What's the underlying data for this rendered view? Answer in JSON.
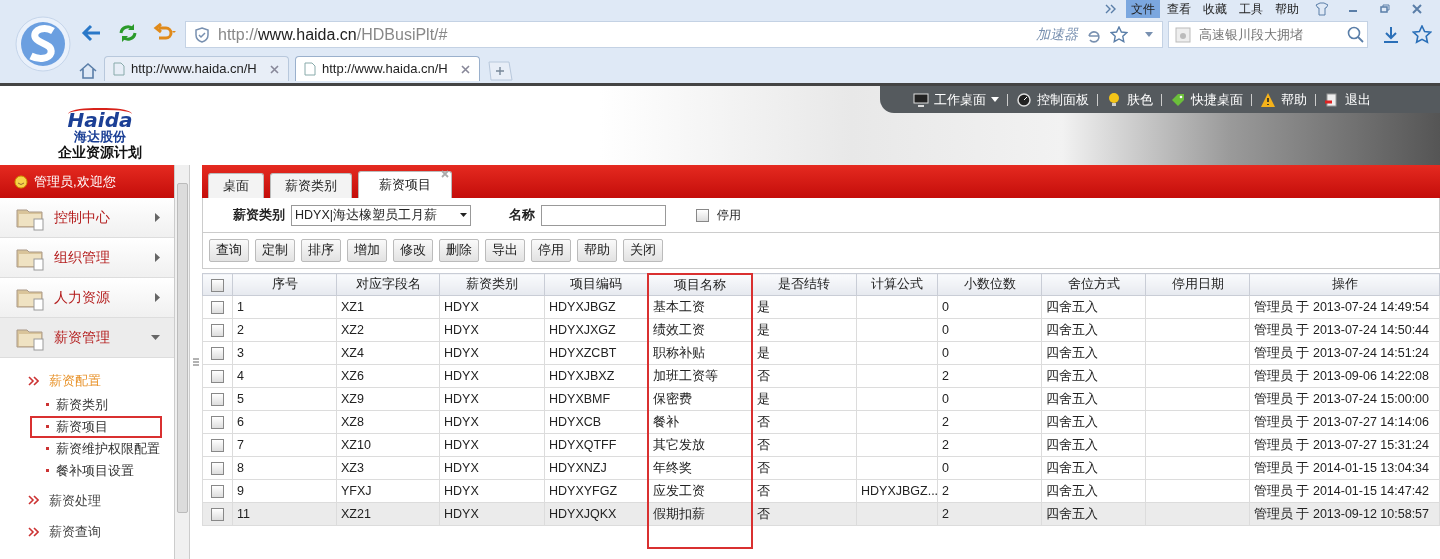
{
  "browser": {
    "menu": [
      {
        "label": "文件",
        "selected": true
      },
      {
        "label": "查看",
        "selected": false
      },
      {
        "label": "收藏",
        "selected": false
      },
      {
        "label": "工具",
        "selected": false
      },
      {
        "label": "帮助",
        "selected": false
      }
    ],
    "address": {
      "scheme": "http://",
      "host": "www.haida.cn",
      "path": "/HDBusiPlt/#"
    },
    "accelerator": "加速器",
    "search": {
      "placeholder": "高速银川段大拥堵"
    },
    "tabs": [
      {
        "label": "http://www.haida.cn/H",
        "selected": false
      },
      {
        "label": "http://www.haida.cn/H",
        "selected": true
      }
    ]
  },
  "header": {
    "logo": {
      "wordmark": "Haida",
      "company": "海达股份",
      "system": "企业资源计划"
    },
    "toolbar": [
      {
        "kind": "monitor",
        "label": "工作桌面",
        "dropdown": true
      },
      {
        "kind": "gauge",
        "label": "控制面板",
        "dropdown": false
      },
      {
        "kind": "bulb",
        "label": "肤色",
        "dropdown": false
      },
      {
        "kind": "tag",
        "label": "快捷桌面",
        "dropdown": false
      },
      {
        "kind": "warning",
        "label": "帮助",
        "dropdown": false
      },
      {
        "kind": "exit",
        "label": "退出",
        "dropdown": false
      }
    ]
  },
  "sidebar": {
    "user": "管理员,欢迎您",
    "groups": [
      {
        "label": "控制中心",
        "expanded": false
      },
      {
        "label": "组织管理",
        "expanded": false
      },
      {
        "label": "人力资源",
        "expanded": false
      },
      {
        "label": "薪资管理",
        "expanded": true,
        "sections": [
          {
            "label": "薪资配置",
            "selected": true,
            "children": [
              {
                "label": "薪资类别",
                "highlighted": false
              },
              {
                "label": "薪资项目",
                "highlighted": true
              },
              {
                "label": "薪资维护权限配置",
                "highlighted": false
              },
              {
                "label": "餐补项目设置",
                "highlighted": false
              }
            ]
          },
          {
            "label": "薪资处理",
            "selected": false
          },
          {
            "label": "薪资查询",
            "selected": false
          }
        ]
      }
    ]
  },
  "tabs": [
    {
      "label": "桌面",
      "selected": false,
      "closable": false
    },
    {
      "label": "薪资类别",
      "selected": false,
      "closable": false
    },
    {
      "label": "薪资项目",
      "selected": true,
      "closable": true
    }
  ],
  "filter": {
    "category_label": "薪资类别",
    "category_value": "HDYX|海达橡塑员工月薪",
    "name_label": "名称",
    "disabled_label": "停用",
    "disabled_checked": false
  },
  "buttons": [
    "查询",
    "定制",
    "排序",
    "增加",
    "修改",
    "删除",
    "导出",
    "停用",
    "帮助",
    "关闭"
  ],
  "table": {
    "select_all_checked": false,
    "columns": [
      {
        "label": "序号",
        "highlighted": false
      },
      {
        "label": "对应字段名",
        "highlighted": false
      },
      {
        "label": "薪资类别",
        "highlighted": false
      },
      {
        "label": "项目编码",
        "highlighted": false
      },
      {
        "label": "项目名称",
        "highlighted": true
      },
      {
        "label": "是否结转",
        "highlighted": false
      },
      {
        "label": "计算公式",
        "highlighted": false
      },
      {
        "label": "小数位数",
        "highlighted": false
      },
      {
        "label": "舍位方式",
        "highlighted": false
      },
      {
        "label": "停用日期",
        "highlighted": false
      },
      {
        "label": "操作",
        "highlighted": false
      }
    ],
    "rows": [
      {
        "selected": false,
        "checked": false,
        "cells": [
          "1",
          "XZ1",
          "HDYX",
          "HDYXJBGZ",
          "基本工资",
          "是",
          "",
          "0",
          "四舍五入",
          "",
          "管理员 于 2013-07-24 14:49:54"
        ]
      },
      {
        "selected": false,
        "checked": false,
        "cells": [
          "2",
          "XZ2",
          "HDYX",
          "HDYXJXGZ",
          "绩效工资",
          "是",
          "",
          "0",
          "四舍五入",
          "",
          "管理员 于 2013-07-24 14:50:44"
        ]
      },
      {
        "selected": false,
        "checked": false,
        "cells": [
          "3",
          "XZ4",
          "HDYX",
          "HDYXZCBT",
          "职称补贴",
          "是",
          "",
          "0",
          "四舍五入",
          "",
          "管理员 于 2013-07-24 14:51:24"
        ]
      },
      {
        "selected": false,
        "checked": false,
        "cells": [
          "4",
          "XZ6",
          "HDYX",
          "HDYXJBXZ",
          "加班工资等",
          "否",
          "",
          "2",
          "四舍五入",
          "",
          "管理员 于 2013-09-06 14:22:08"
        ]
      },
      {
        "selected": false,
        "checked": false,
        "cells": [
          "5",
          "XZ9",
          "HDYX",
          "HDYXBMF",
          "保密费",
          "是",
          "",
          "0",
          "四舍五入",
          "",
          "管理员 于 2013-07-24 15:00:00"
        ]
      },
      {
        "selected": false,
        "checked": false,
        "cells": [
          "6",
          "XZ8",
          "HDYX",
          "HDYXCB",
          "餐补",
          "否",
          "",
          "2",
          "四舍五入",
          "",
          "管理员 于 2013-07-27 14:14:06"
        ]
      },
      {
        "selected": false,
        "checked": false,
        "cells": [
          "7",
          "XZ10",
          "HDYX",
          "HDYXQTFF",
          "其它发放",
          "否",
          "",
          "2",
          "四舍五入",
          "",
          "管理员 于 2013-07-27 15:31:24"
        ]
      },
      {
        "selected": false,
        "checked": false,
        "cells": [
          "8",
          "XZ3",
          "HDYX",
          "HDYXNZJ",
          "年终奖",
          "否",
          "",
          "0",
          "四舍五入",
          "",
          "管理员 于 2014-01-15 13:04:34"
        ]
      },
      {
        "selected": false,
        "checked": false,
        "cells": [
          "9",
          "YFXJ",
          "HDYX",
          "HDYXYFGZ",
          "应发工资",
          "否",
          "HDYXJBGZ...",
          "2",
          "四舍五入",
          "",
          "管理员 于 2014-01-15 14:47:42"
        ]
      },
      {
        "selected": true,
        "checked": false,
        "cells": [
          "11",
          "XZ21",
          "HDYX",
          "HDYXJQKX",
          "假期扣薪",
          "否",
          "",
          "2",
          "四舍五入",
          "",
          "管理员 于 2013-09-12 10:58:57"
        ]
      }
    ]
  }
}
